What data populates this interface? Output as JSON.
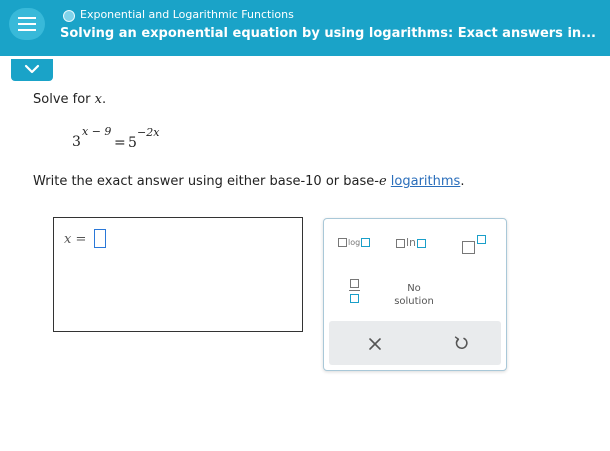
{
  "header": {
    "topic": "Exponential and Logarithmic Functions",
    "title": "Solving an exponential equation by using logarithms: Exact answers in..."
  },
  "problem": {
    "prompt_text": "Solve for ",
    "prompt_var": "x",
    "prompt_end": ".",
    "equation": {
      "left_base": "3",
      "left_exponent": "x − 9",
      "equals": "=",
      "right_base": "5",
      "right_exponent": "−2x"
    },
    "instruction_before": "Write the exact answer using either base-10 or base-",
    "instruction_e": "e",
    "instruction_mid": " ",
    "instruction_link": "logarithms",
    "instruction_after": "."
  },
  "answer": {
    "variable": "x",
    "equals": "=",
    "value": ""
  },
  "keypad": {
    "log_label": "log",
    "ln_label": "ln",
    "no_solution_line1": "No",
    "no_solution_line2": "solution",
    "clear_icon": "x-icon",
    "undo_icon": "undo-icon"
  },
  "colors": {
    "header": "#1aa3c8",
    "accent": "#1a9fc9",
    "link": "#2a6ebb",
    "input_border": "#2a78d8"
  }
}
